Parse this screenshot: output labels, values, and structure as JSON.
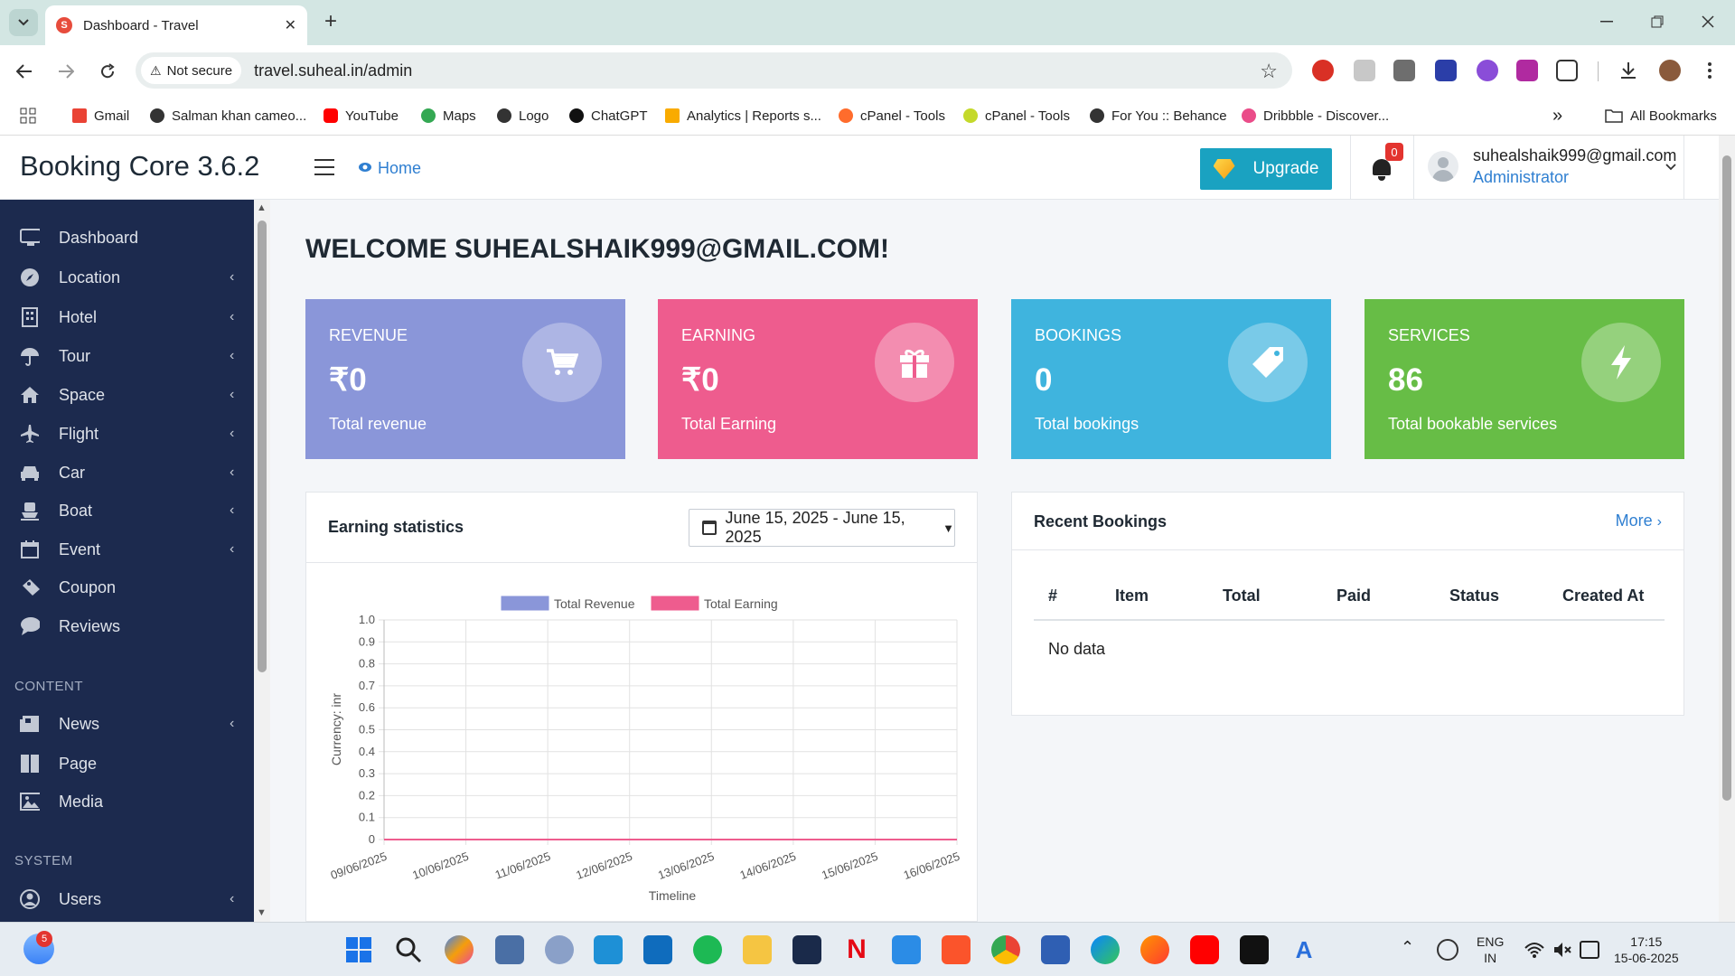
{
  "browser": {
    "tab_title": "Dashboard - Travel",
    "tab_close": "✕",
    "new_tab": "+",
    "not_secure": "Not secure",
    "url": "travel.suheal.in/admin",
    "bookmarks": [
      "Gmail",
      "Salman khan cameo...",
      "YouTube",
      "Maps",
      "Logo",
      "ChatGPT",
      "Analytics | Reports s...",
      "cPanel - Tools",
      "cPanel - Tools",
      "For You :: Behance",
      "Dribbble - Discover..."
    ],
    "bookmarks_overflow": "»",
    "all_bookmarks": "All Bookmarks"
  },
  "header": {
    "brand": "Booking Core 3.6.2",
    "home": "Home",
    "upgrade": "Upgrade",
    "notif_count": "0",
    "user_email": "suhealshaik999@gmail.com",
    "user_role": "Administrator"
  },
  "sidebar": {
    "items": [
      {
        "label": "Dashboard",
        "icon": "monitor-icon",
        "has_submenu": false
      },
      {
        "label": "Location",
        "icon": "compass-icon",
        "has_submenu": true
      },
      {
        "label": "Hotel",
        "icon": "building-icon",
        "has_submenu": true
      },
      {
        "label": "Tour",
        "icon": "umbrella-icon",
        "has_submenu": true
      },
      {
        "label": "Space",
        "icon": "home-icon",
        "has_submenu": true
      },
      {
        "label": "Flight",
        "icon": "plane-icon",
        "has_submenu": true
      },
      {
        "label": "Car",
        "icon": "car-icon",
        "has_submenu": true
      },
      {
        "label": "Boat",
        "icon": "ship-icon",
        "has_submenu": true
      },
      {
        "label": "Event",
        "icon": "calendar-icon",
        "has_submenu": true
      },
      {
        "label": "Coupon",
        "icon": "ticket-icon",
        "has_submenu": false
      },
      {
        "label": "Reviews",
        "icon": "comment-icon",
        "has_submenu": false
      }
    ],
    "content_section": "CONTENT",
    "content_items": [
      {
        "label": "News",
        "icon": "newspaper-icon",
        "has_submenu": true
      },
      {
        "label": "Page",
        "icon": "book-icon",
        "has_submenu": false
      },
      {
        "label": "Media",
        "icon": "image-icon",
        "has_submenu": false
      }
    ],
    "system_section": "SYSTEM",
    "system_items": [
      {
        "label": "Users",
        "icon": "user-icon",
        "has_submenu": true
      }
    ]
  },
  "main": {
    "welcome": "WELCOME SUHEALSHAIK999@GMAIL.COM!",
    "cards": [
      {
        "title": "REVENUE",
        "value": "₹0",
        "sub": "Total revenue",
        "color": "#8a96d9",
        "icon": "cart-icon"
      },
      {
        "title": "EARNING",
        "value": "₹0",
        "sub": "Total Earning",
        "color": "#ee5c8e",
        "icon": "gift-icon"
      },
      {
        "title": "BOOKINGS",
        "value": "0",
        "sub": "Total bookings",
        "color": "#3fb4de",
        "icon": "tag-icon"
      },
      {
        "title": "SERVICES",
        "value": "86",
        "sub": "Total bookable services",
        "color": "#67bd46",
        "icon": "bolt-icon"
      }
    ],
    "earning": {
      "title": "Earning statistics",
      "date_range": "June 15, 2025 - June 15, 2025"
    },
    "recent": {
      "title": "Recent Bookings",
      "more": "More",
      "columns": [
        "#",
        "Item",
        "Total",
        "Paid",
        "Status",
        "Created At"
      ],
      "empty": "No data"
    }
  },
  "chart_data": {
    "type": "line",
    "x": [
      "09/06/2025",
      "10/06/2025",
      "11/06/2025",
      "12/06/2025",
      "13/06/2025",
      "14/06/2025",
      "15/06/2025",
      "16/06/2025"
    ],
    "series": [
      {
        "name": "Total Revenue",
        "values": [
          0,
          0,
          0,
          0,
          0,
          0,
          0,
          0
        ],
        "color": "#8a96d9"
      },
      {
        "name": "Total Earning",
        "values": [
          0,
          0,
          0,
          0,
          0,
          0,
          0,
          0
        ],
        "color": "#ee5c8e"
      }
    ],
    "yticks": [
      "0",
      "0.1",
      "0.2",
      "0.3",
      "0.4",
      "0.5",
      "0.6",
      "0.7",
      "0.8",
      "0.9",
      "1.0"
    ],
    "ylim": [
      0,
      1
    ],
    "xlabel": "Timeline",
    "ylabel": "Currency: inr",
    "grid": true,
    "legend": "top"
  },
  "taskbar": {
    "weather_badge": "5",
    "lang": "ENG",
    "region": "IN",
    "time": "17:15",
    "date": "15-06-2025"
  }
}
